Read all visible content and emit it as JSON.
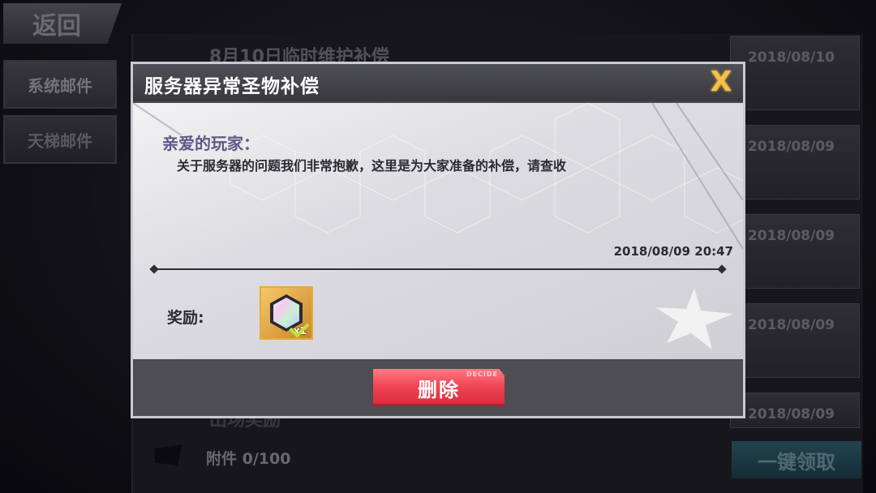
{
  "background": {
    "back_label": "返回",
    "side_tabs": [
      {
        "label": "系统邮件"
      },
      {
        "label": "天梯邮件"
      }
    ],
    "mail_list": [
      {
        "title": "8月10日临时维护补偿",
        "date": "2018/08/10"
      },
      {
        "date": "2018/08/09"
      },
      {
        "date": "2018/08/09"
      },
      {
        "date": "2018/08/09"
      },
      {
        "title": "出场奖励",
        "date": "2018/08/09"
      }
    ],
    "attachment_count": "附件 0/100",
    "claim_all_label": "一键领取"
  },
  "dialog": {
    "title": "服务器异常圣物补偿",
    "close_glyph": "X",
    "greeting": "亲爱的玩家：",
    "message": "关于服务器的问题我们非常抱歉，这里是为大家准备的补偿，请查收",
    "datetime": "2018/08/09 20:47",
    "reward_label": "奖励:",
    "reward_item": {
      "icon": "prismatic-hexagon-crystal-icon",
      "quantity": "x1",
      "claimed": true
    },
    "delete_label": "删除",
    "delete_tag": "DECIDE"
  },
  "colors": {
    "accent_gold": "#f4c04a",
    "delete_red": "#f04656",
    "greeting_purple": "#5d5a86"
  }
}
